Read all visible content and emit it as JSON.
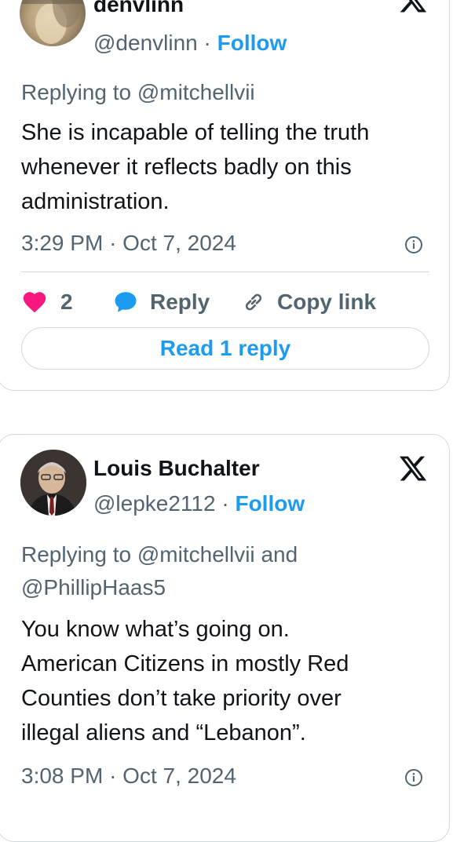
{
  "tweets": [
    {
      "author_name": "denvlinn",
      "handle": "@denvlinn",
      "separator": "·",
      "follow_label": "Follow",
      "replying_prefix": "Replying to",
      "replying_mentions": [
        "@mitchellvii"
      ],
      "text_lines": [
        "She is incapable of telling the truth",
        "whenever it reflects badly on this",
        "administration."
      ],
      "time": "3:29 PM",
      "date": "Oct 7, 2024",
      "likes": "2",
      "reply_label": "Reply",
      "copy_link_label": "Copy link",
      "read_replies_label": "Read 1 reply"
    },
    {
      "author_name": "Louis Buchalter",
      "handle": "@lepke2112",
      "separator": "·",
      "follow_label": "Follow",
      "replying_prefix": "Replying to",
      "replying_mentions": [
        "@mitchellvii",
        "@PhillipHaas5"
      ],
      "replying_joiner": "and",
      "text_lines": [
        "You know what’s going on.",
        "American Citizens in mostly Red",
        "Counties don’t take priority over",
        "illegal aliens and “Lebanon”."
      ],
      "time": "3:08 PM",
      "date": "Oct 7, 2024"
    }
  ],
  "icons": {
    "heart_color": "#f91880",
    "reply_bubble_color": "#1d9bf0",
    "follow_color": "#1d9bf0",
    "secondary_text_color": "#536471"
  }
}
